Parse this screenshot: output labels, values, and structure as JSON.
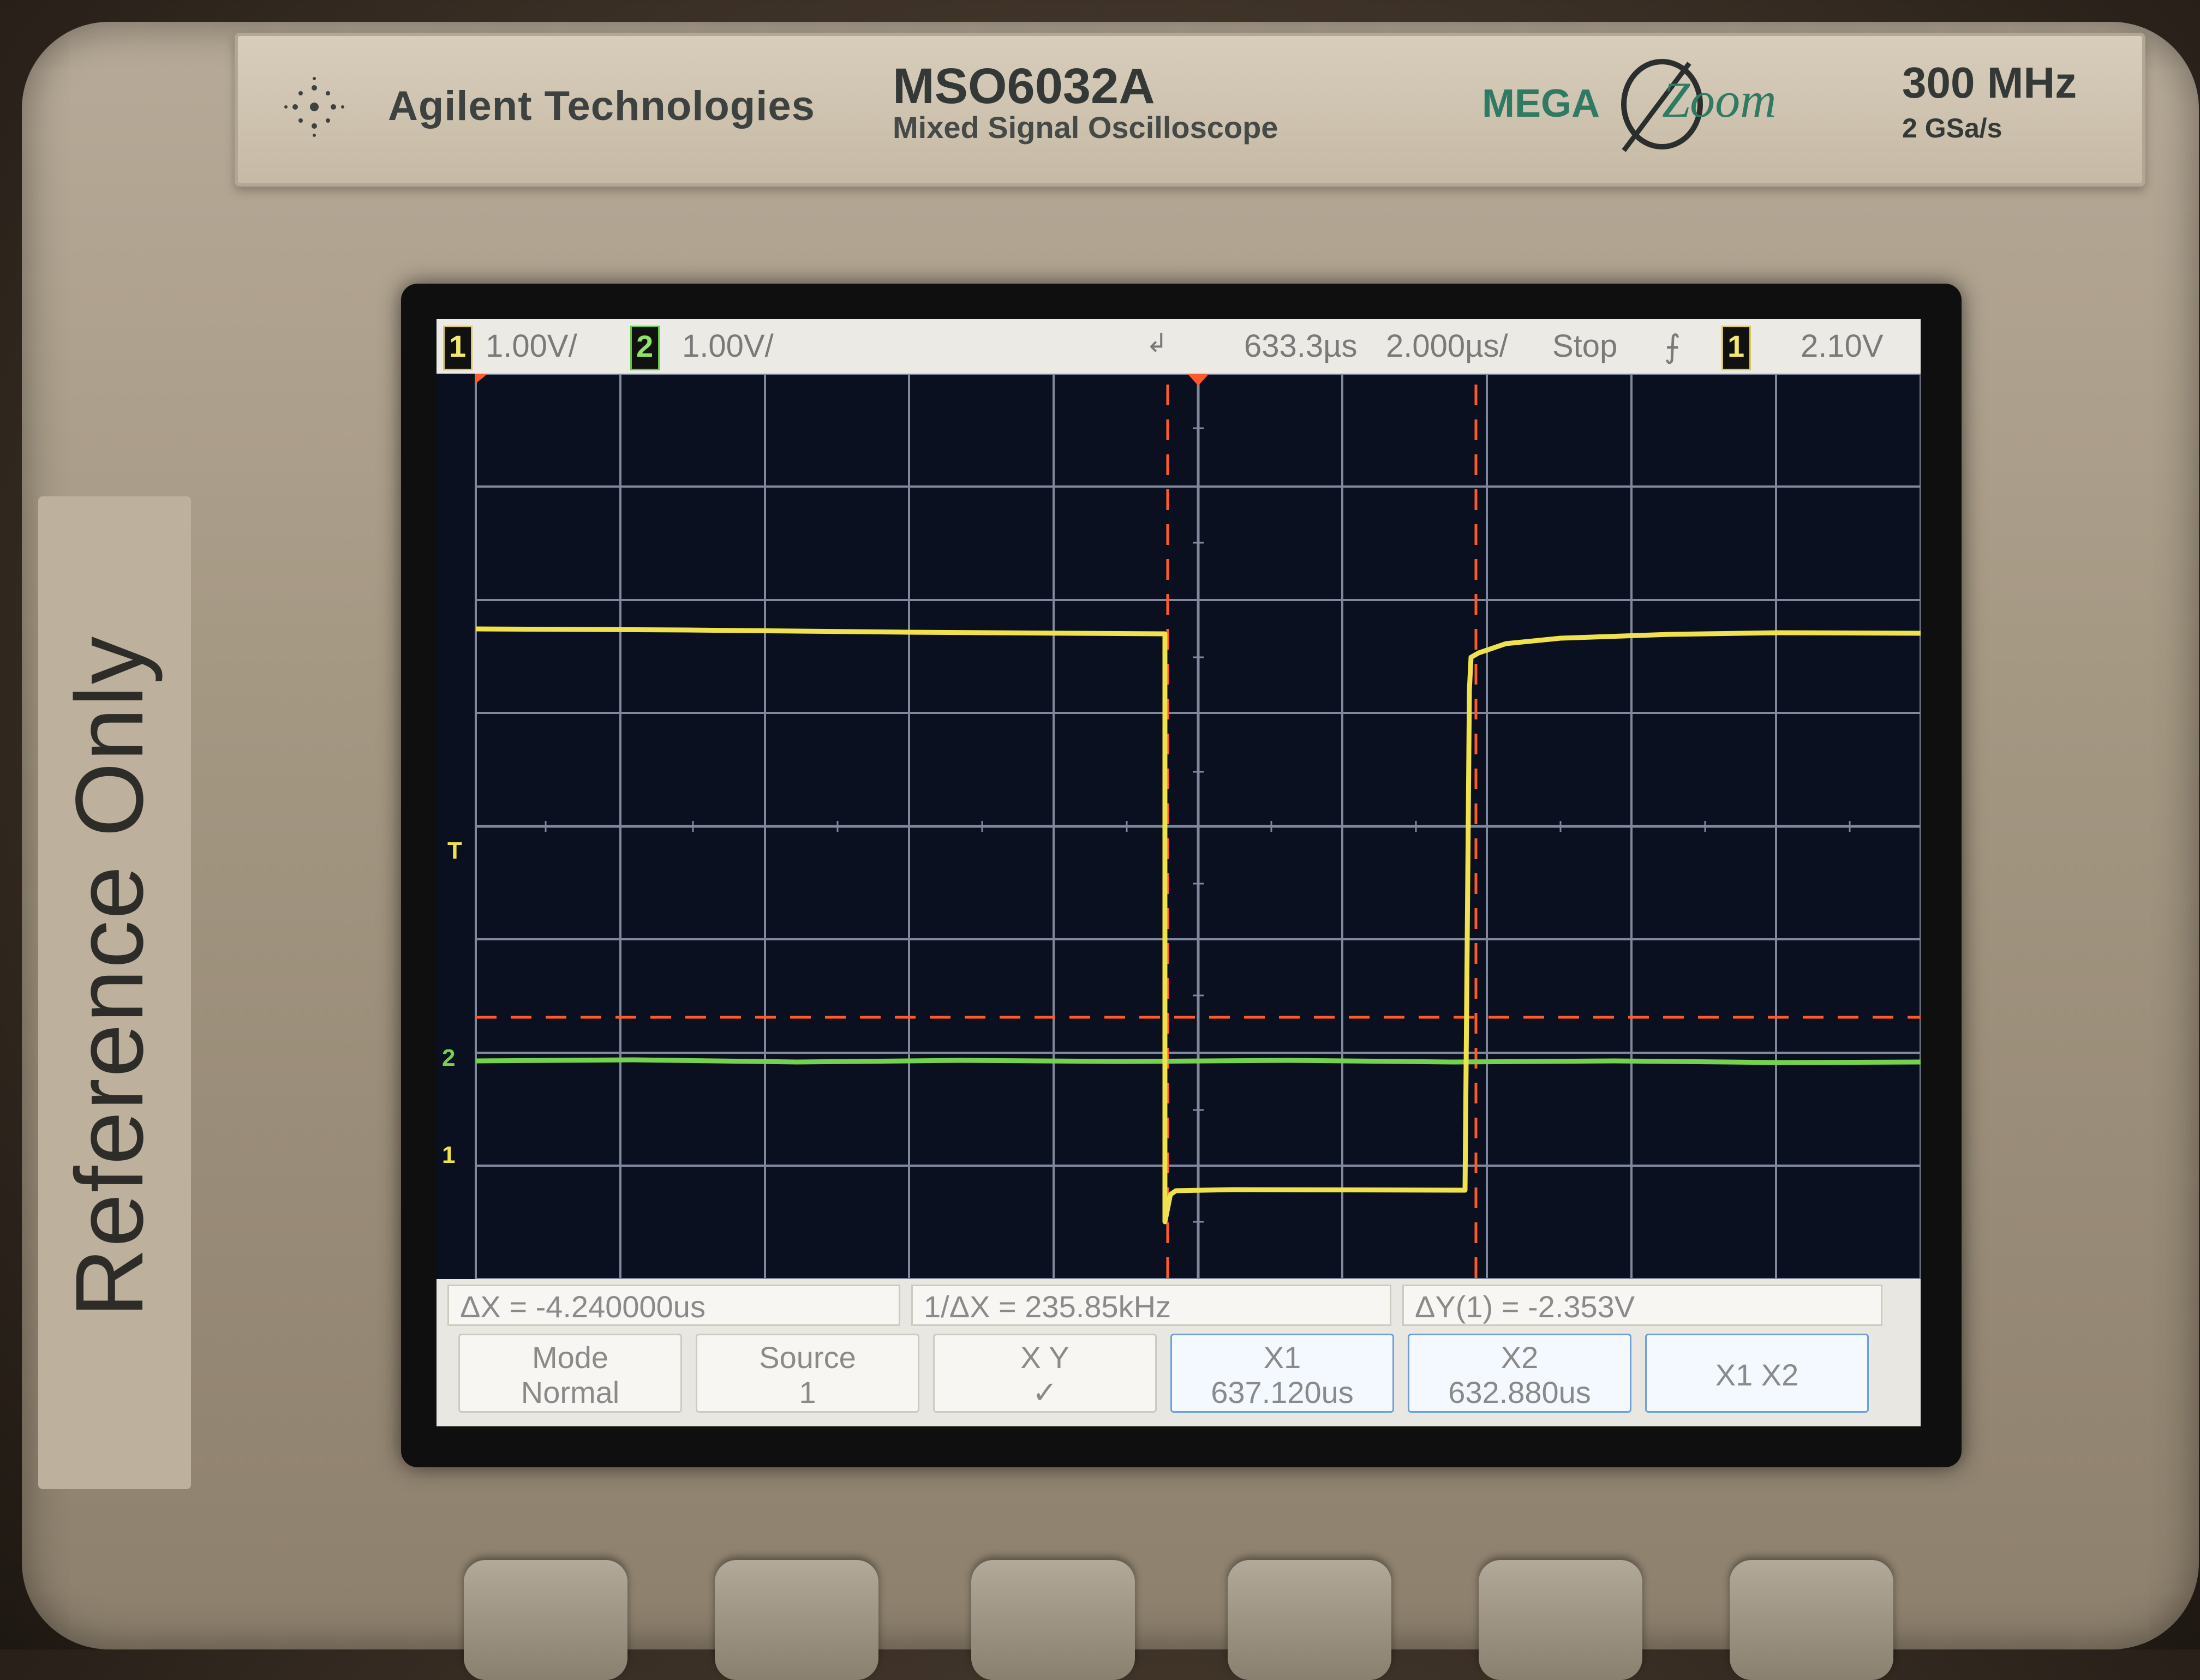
{
  "brand": {
    "company": "Agilent Technologies",
    "model": "MSO6032A",
    "model_subtitle": "Mixed Signal Oscilloscope",
    "megazoom_mega": "MEGA",
    "megazoom_zoom": "Zoom",
    "bandwidth": "300 MHz",
    "sample_rate": "2 GSa/s"
  },
  "side_label": "Reference Only",
  "status_bar": {
    "ch1_number": "1",
    "ch1_scale": "1.00V/",
    "ch2_number": "2",
    "ch2_scale": "1.00V/",
    "time_delay": "633.3µs",
    "time_scale": "2.000µs/",
    "run_state": "Stop",
    "trigger_edge": "⨍",
    "trigger_source": "1",
    "trigger_level": "2.10V"
  },
  "markers": {
    "trigger_label": "T",
    "ch2_label": "2",
    "ch1_label": "1"
  },
  "readouts": {
    "delta_x": "ΔX = -4.240000us",
    "inv_delta_x": "1/ΔX = 235.85kHz",
    "delta_y": "ΔY(1) = -2.353V"
  },
  "softkeys": [
    {
      "line1": "Mode",
      "line2": "Normal"
    },
    {
      "line1": "Source",
      "line2": "1"
    },
    {
      "line1": "X       Y",
      "line2": "✓"
    },
    {
      "line1": "X1",
      "line2": "637.120us"
    },
    {
      "line1": "X2",
      "line2": "632.880us"
    },
    {
      "line1": "X1 X2",
      "line2": ""
    }
  ],
  "colors": {
    "ch1": "#f0e24c",
    "ch2": "#74d24e",
    "cursor": "#ff5a2a",
    "grid": "#8a93a8"
  }
}
